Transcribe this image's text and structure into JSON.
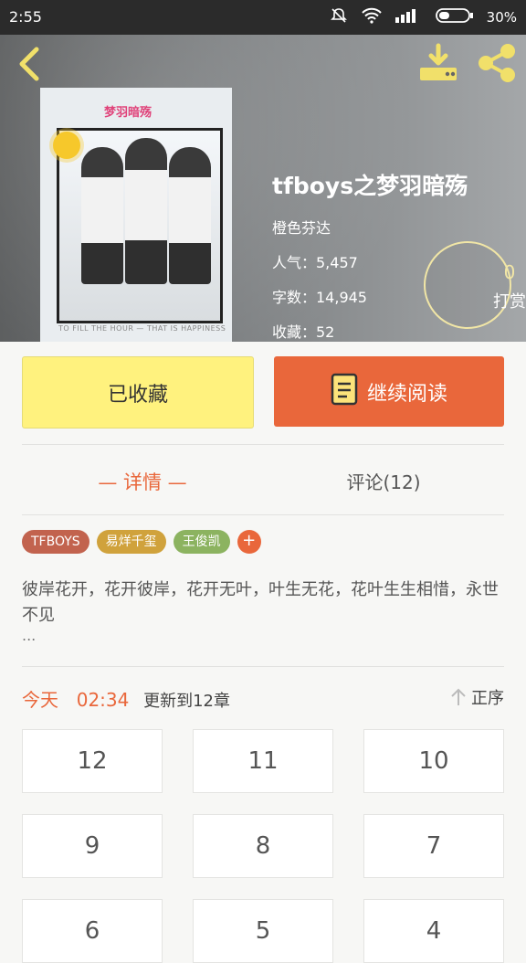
{
  "status_bar": {
    "time": "2:55",
    "battery_percent": "30%"
  },
  "book": {
    "title": "tfboys之梦羽暗殇",
    "author": "橙色芬达",
    "popularity": "人气：5,457",
    "word_count": "字数：14,945",
    "favorites": "收藏：52",
    "cover_title": "梦羽暗殇",
    "cover_caption": "TO FILL THE HOUR — THAT IS HAPPINESS"
  },
  "reward": {
    "count": "0",
    "label": "打赏"
  },
  "actions": {
    "collect_label": "已收藏",
    "read_label": "继续阅读"
  },
  "tabs": {
    "detail": "— 详情 —",
    "comments": "评论(12)"
  },
  "tags": [
    {
      "label": "TFBOYS",
      "color": "#c2634e"
    },
    {
      "label": "易烊千玺",
      "color": "#d0a23c"
    },
    {
      "label": "王俊凯",
      "color": "#8cb360"
    }
  ],
  "tag_add": "+",
  "description": {
    "text": "彼岸花开，花开彼岸，花开无叶，叶生无花，花叶生生相惜，永世不见",
    "ellipsis": "..."
  },
  "update": {
    "day": "今天",
    "time": "02:34",
    "status": "更新到12章",
    "sort_label": "正序"
  },
  "chapters": [
    "12",
    "11",
    "10",
    "9",
    "8",
    "7",
    "6",
    "5",
    "4"
  ],
  "colors": {
    "accent": "#e9673b",
    "collect_button": "#fff27e"
  }
}
